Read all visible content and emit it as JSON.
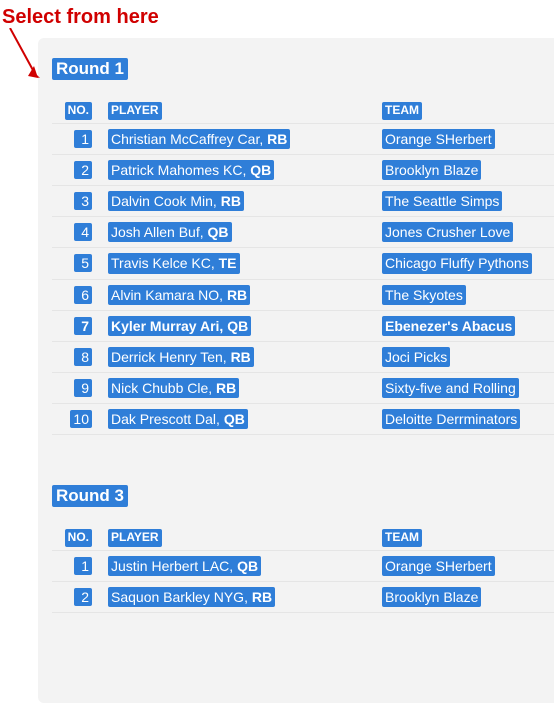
{
  "annotation": {
    "label": "Select from here"
  },
  "headers": {
    "no": "NO.",
    "player": "PLAYER",
    "team": "TEAM"
  },
  "rounds": [
    {
      "title": "Round 1",
      "rows": [
        {
          "no": "1",
          "player_pre": "Christian McCaffrey Car, ",
          "pos": "RB",
          "team": "Orange SHerbert",
          "bold": false
        },
        {
          "no": "2",
          "player_pre": "Patrick Mahomes KC, ",
          "pos": "QB",
          "team": "Brooklyn Blaze",
          "bold": false
        },
        {
          "no": "3",
          "player_pre": "Dalvin Cook Min, ",
          "pos": "RB",
          "team": "The Seattle Simps",
          "bold": false
        },
        {
          "no": "4",
          "player_pre": "Josh Allen Buf, ",
          "pos": "QB",
          "team": "Jones Crusher Love",
          "bold": false
        },
        {
          "no": "5",
          "player_pre": "Travis Kelce KC, ",
          "pos": "TE",
          "team": "Chicago Fluffy Pythons",
          "bold": false
        },
        {
          "no": "6",
          "player_pre": "Alvin Kamara NO, ",
          "pos": "RB",
          "team": "The Skyotes",
          "bold": false
        },
        {
          "no": "7",
          "player_pre": "Kyler Murray Ari, ",
          "pos": "QB",
          "team": "Ebenezer's Abacus",
          "bold": true
        },
        {
          "no": "8",
          "player_pre": "Derrick Henry Ten, ",
          "pos": "RB",
          "team": "Joci Picks",
          "bold": false
        },
        {
          "no": "9",
          "player_pre": "Nick Chubb Cle, ",
          "pos": "RB",
          "team": "Sixty-five and Rolling",
          "bold": false
        },
        {
          "no": "10",
          "player_pre": "Dak Prescott Dal, ",
          "pos": "QB",
          "team": "Deloitte Derrminators",
          "bold": false
        }
      ]
    },
    {
      "title": "Round 3",
      "rows": [
        {
          "no": "1",
          "player_pre": "Justin Herbert LAC, ",
          "pos": "QB",
          "team": "Orange SHerbert",
          "bold": false
        },
        {
          "no": "2",
          "player_pre": "Saquon Barkley NYG, ",
          "pos": "RB",
          "team": "Brooklyn Blaze",
          "bold": false
        }
      ]
    }
  ]
}
